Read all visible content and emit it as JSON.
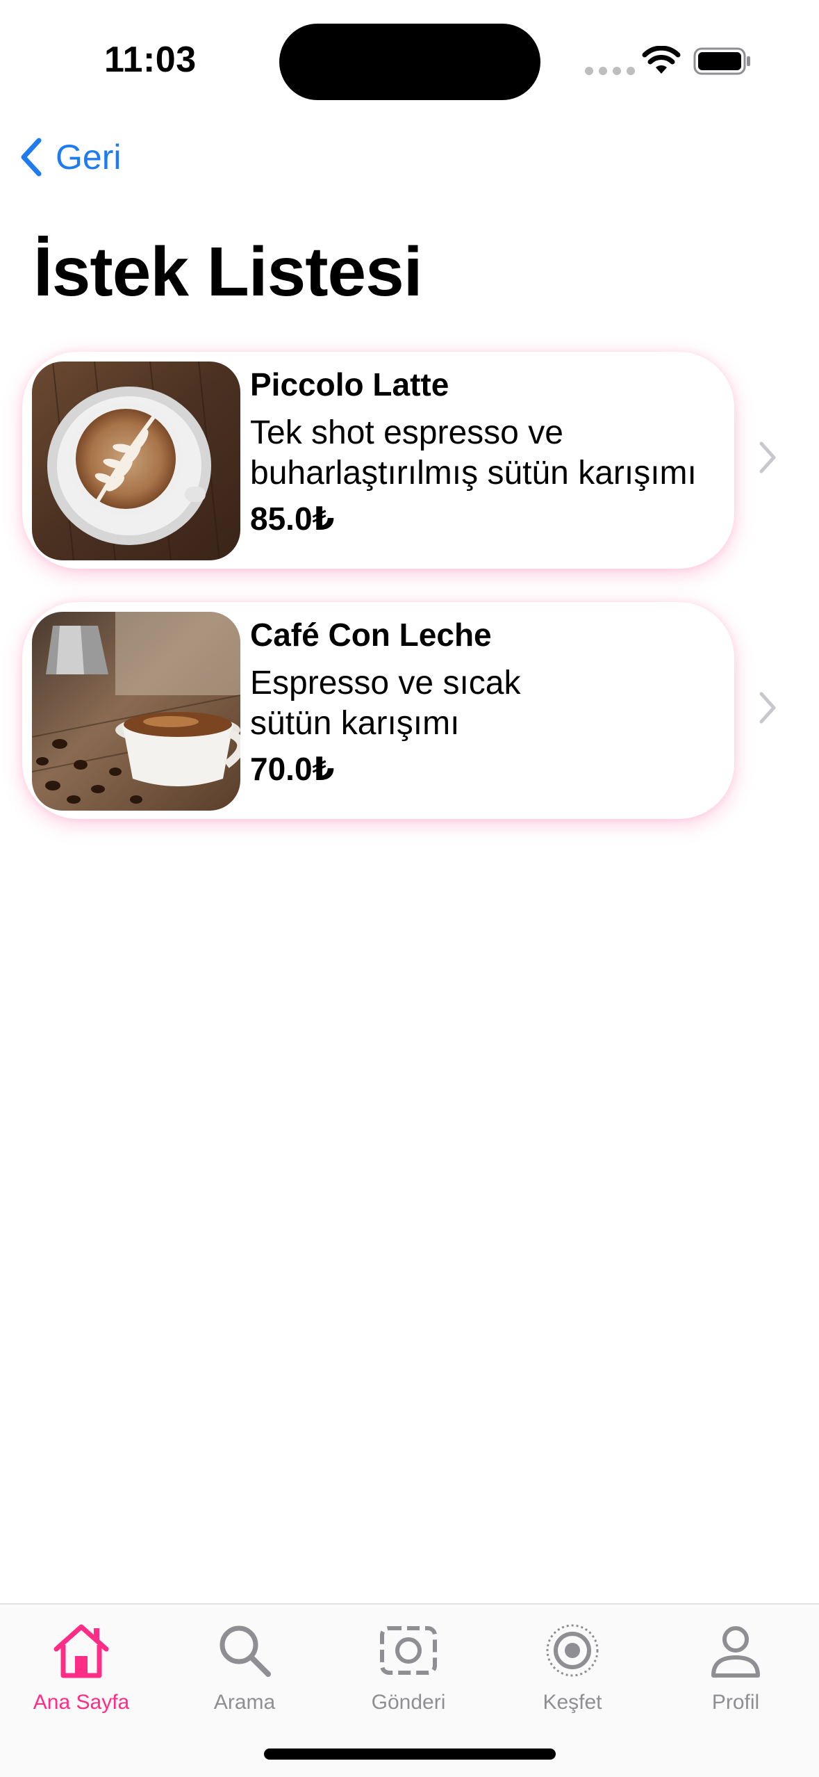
{
  "status_bar": {
    "time": "11:03"
  },
  "nav": {
    "back_label": "Geri",
    "title": "İstek Listesi"
  },
  "wishlist": [
    {
      "name": "Piccolo Latte",
      "description": "Tek shot espresso ve buharlaştırılmış sütün karışımı",
      "price": "85.0₺",
      "image_icon": "latte-art-cup"
    },
    {
      "name": "Café Con Leche",
      "description": "Espresso ve sıcak sütün karışımı",
      "price": "70.0₺",
      "image_icon": "espresso-cup-with-beans"
    }
  ],
  "tab_bar": {
    "tabs": [
      {
        "label": "Ana Sayfa",
        "icon": "house-icon",
        "active": true
      },
      {
        "label": "Arama",
        "icon": "search-icon",
        "active": false
      },
      {
        "label": "Gönderi",
        "icon": "camera-frame-icon",
        "active": false
      },
      {
        "label": "Keşfet",
        "icon": "target-icon",
        "active": false
      },
      {
        "label": "Profil",
        "icon": "person-icon",
        "active": false
      }
    ]
  },
  "colors": {
    "accent": "#ff2d86",
    "link": "#1e7bf2",
    "inactive": "#8e8e93"
  }
}
